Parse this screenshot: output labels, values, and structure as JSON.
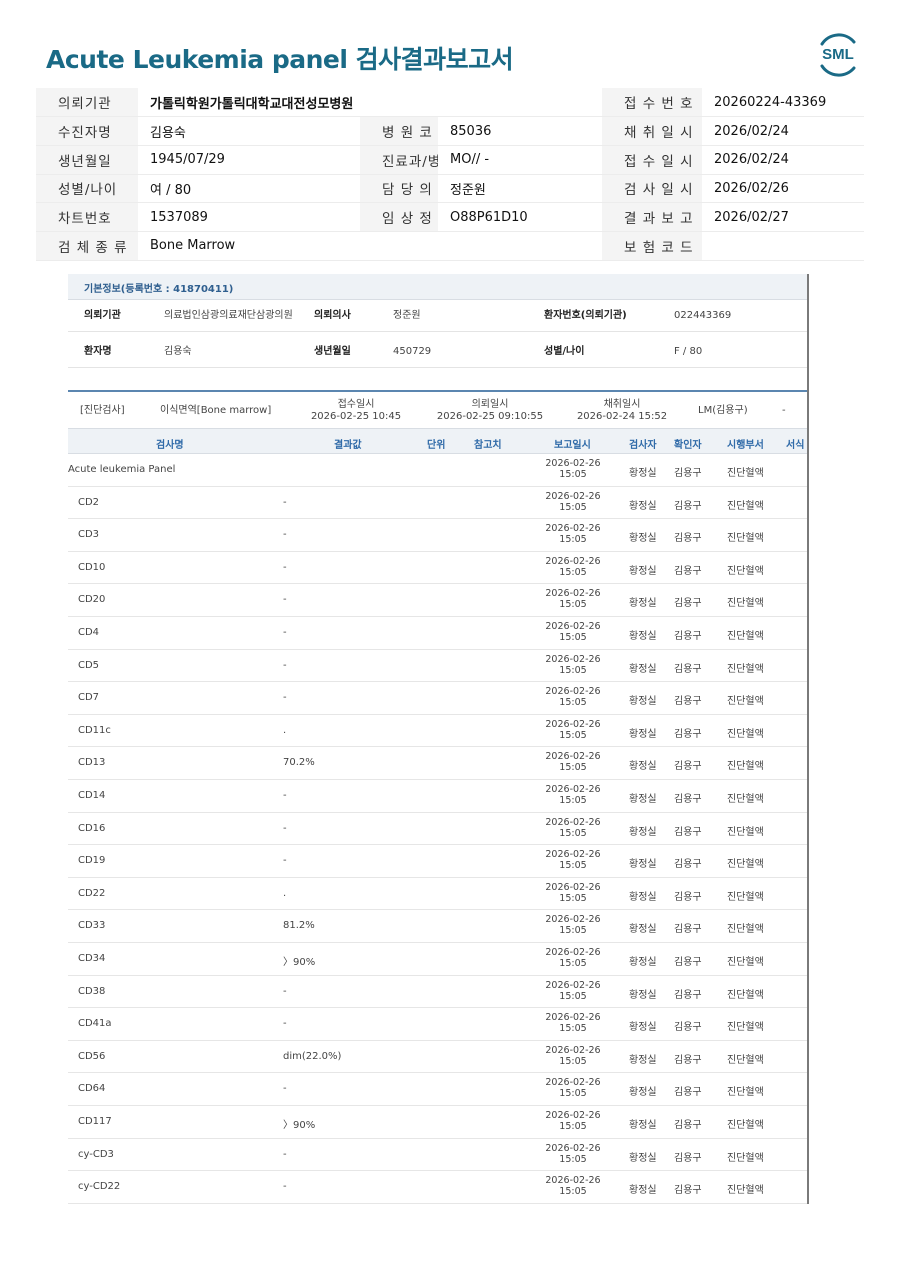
{
  "header": {
    "title": "Acute Leukemia panel 검사결과보고서",
    "logo_text": "SML"
  },
  "patient_table": [
    [
      "의뢰기관",
      "가톨릭학원가톨릭대학교대전성모병원",
      "",
      "",
      "접 수 번 호",
      "20260224-43369"
    ],
    [
      "수진자명",
      "김용숙",
      "병 원 코 드",
      "85036",
      "채 취 일 시",
      "2026/02/24"
    ],
    [
      "생년월일",
      "1945/07/29",
      "진료과/병동",
      "MO// -",
      "접 수 일 시",
      "2026/02/24"
    ],
    [
      "성별/나이",
      "여 / 80",
      "담 당 의 사",
      "정준원",
      "검 사 일 시",
      "2026/02/26"
    ],
    [
      "차트번호",
      "1537089",
      "임 상 정 보",
      "O88P61D10",
      "결 과 보 고",
      "2026/02/27"
    ],
    [
      "검 체 종 류",
      "Bone Marrow",
      "",
      "",
      "보 험 코 드",
      ""
    ]
  ],
  "basic_info": {
    "heading": "기본정보(등록번호 : 41870411)",
    "row1": {
      "l1": "의뢰기관",
      "v1": "의료법인삼광의료재단삼광의원",
      "l2": "의뢰의사",
      "v2": "정준원",
      "l3": "환자번호(의뢰기관)",
      "v3": "022443369"
    },
    "row2": {
      "l1": "환자명",
      "v1": "김용숙",
      "l2": "생년월일",
      "v2": "450729",
      "l3": "성별/나이",
      "v3": "F / 80"
    }
  },
  "diagnosis_row": {
    "category": "[진단검사]",
    "specimen": "이식면역[Bone marrow]",
    "receipt_label": "접수일시",
    "receipt_value": "2026-02-25 10:45",
    "request_label": "의뢰일시",
    "request_value": "2026-02-25 09:10:55",
    "collect_label": "채취일시",
    "collect_value": "2026-02-24 15:52",
    "doctor": "LM(김용구)",
    "extra": "-"
  },
  "results_header": [
    "검사명",
    "결과값",
    "단위",
    "참고치",
    "보고일시",
    "검사자",
    "확인자",
    "시행부서",
    "서식"
  ],
  "results": [
    {
      "name": "Acute leukemia Panel",
      "result": "",
      "report_date": "2026-02-26",
      "report_time": "15:05",
      "examiner": "황정실",
      "confirmer": "김용구",
      "dept": "진단혈액"
    },
    {
      "name": "CD2",
      "result": "-",
      "report_date": "2026-02-26",
      "report_time": "15:05",
      "examiner": "황정실",
      "confirmer": "김용구",
      "dept": "진단혈액"
    },
    {
      "name": "CD3",
      "result": "-",
      "report_date": "2026-02-26",
      "report_time": "15:05",
      "examiner": "황정실",
      "confirmer": "김용구",
      "dept": "진단혈액"
    },
    {
      "name": "CD10",
      "result": "-",
      "report_date": "2026-02-26",
      "report_time": "15:05",
      "examiner": "황정실",
      "confirmer": "김용구",
      "dept": "진단혈액"
    },
    {
      "name": "CD20",
      "result": "-",
      "report_date": "2026-02-26",
      "report_time": "15:05",
      "examiner": "황정실",
      "confirmer": "김용구",
      "dept": "진단혈액"
    },
    {
      "name": "CD4",
      "result": "-",
      "report_date": "2026-02-26",
      "report_time": "15:05",
      "examiner": "황정실",
      "confirmer": "김용구",
      "dept": "진단혈액"
    },
    {
      "name": "CD5",
      "result": "-",
      "report_date": "2026-02-26",
      "report_time": "15:05",
      "examiner": "황정실",
      "confirmer": "김용구",
      "dept": "진단혈액"
    },
    {
      "name": "CD7",
      "result": "-",
      "report_date": "2026-02-26",
      "report_time": "15:05",
      "examiner": "황정실",
      "confirmer": "김용구",
      "dept": "진단혈액"
    },
    {
      "name": "CD11c",
      "result": ".",
      "report_date": "2026-02-26",
      "report_time": "15:05",
      "examiner": "황정실",
      "confirmer": "김용구",
      "dept": "진단혈액"
    },
    {
      "name": "CD13",
      "result": "70.2%",
      "report_date": "2026-02-26",
      "report_time": "15:05",
      "examiner": "황정실",
      "confirmer": "김용구",
      "dept": "진단혈액"
    },
    {
      "name": "CD14",
      "result": "-",
      "report_date": "2026-02-26",
      "report_time": "15:05",
      "examiner": "황정실",
      "confirmer": "김용구",
      "dept": "진단혈액"
    },
    {
      "name": "CD16",
      "result": "-",
      "report_date": "2026-02-26",
      "report_time": "15:05",
      "examiner": "황정실",
      "confirmer": "김용구",
      "dept": "진단혈액"
    },
    {
      "name": "CD19",
      "result": "-",
      "report_date": "2026-02-26",
      "report_time": "15:05",
      "examiner": "황정실",
      "confirmer": "김용구",
      "dept": "진단혈액"
    },
    {
      "name": "CD22",
      "result": ".",
      "report_date": "2026-02-26",
      "report_time": "15:05",
      "examiner": "황정실",
      "confirmer": "김용구",
      "dept": "진단혈액"
    },
    {
      "name": "CD33",
      "result": "81.2%",
      "report_date": "2026-02-26",
      "report_time": "15:05",
      "examiner": "황정실",
      "confirmer": "김용구",
      "dept": "진단혈액"
    },
    {
      "name": "CD34",
      "result": "〉90%",
      "report_date": "2026-02-26",
      "report_time": "15:05",
      "examiner": "황정실",
      "confirmer": "김용구",
      "dept": "진단혈액"
    },
    {
      "name": "CD38",
      "result": "-",
      "report_date": "2026-02-26",
      "report_time": "15:05",
      "examiner": "황정실",
      "confirmer": "김용구",
      "dept": "진단혈액"
    },
    {
      "name": "CD41a",
      "result": "-",
      "report_date": "2026-02-26",
      "report_time": "15:05",
      "examiner": "황정실",
      "confirmer": "김용구",
      "dept": "진단혈액"
    },
    {
      "name": "CD56",
      "result": "dim(22.0%)",
      "report_date": "2026-02-26",
      "report_time": "15:05",
      "examiner": "황정실",
      "confirmer": "김용구",
      "dept": "진단혈액"
    },
    {
      "name": "CD64",
      "result": "-",
      "report_date": "2026-02-26",
      "report_time": "15:05",
      "examiner": "황정실",
      "confirmer": "김용구",
      "dept": "진단혈액"
    },
    {
      "name": "CD117",
      "result": "〉90%",
      "report_date": "2026-02-26",
      "report_time": "15:05",
      "examiner": "황정실",
      "confirmer": "김용구",
      "dept": "진단혈액"
    },
    {
      "name": "cy-CD3",
      "result": "-",
      "report_date": "2026-02-26",
      "report_time": "15:05",
      "examiner": "황정실",
      "confirmer": "김용구",
      "dept": "진단혈액"
    },
    {
      "name": "cy-CD22",
      "result": "-",
      "report_date": "2026-02-26",
      "report_time": "15:05",
      "examiner": "황정실",
      "confirmer": "김용구",
      "dept": "진단혈액"
    }
  ]
}
